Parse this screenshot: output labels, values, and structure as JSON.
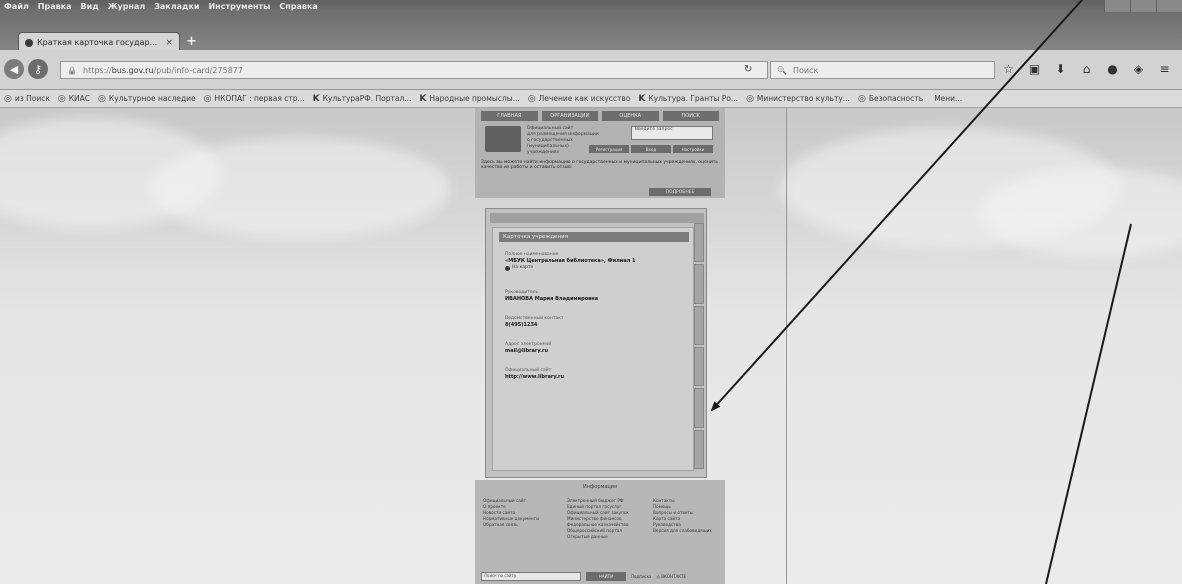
{
  "browser": {
    "menu": [
      "Файл",
      "Правка",
      "Вид",
      "Журнал",
      "Закладки",
      "Инструменты",
      "Справка"
    ],
    "tab_title": "Краткая карточка государ...",
    "tab_close": "×",
    "new_tab": "+",
    "url": {
      "prefix": "https://",
      "host": "bus.gov.ru",
      "path": "/pub/info-card/275877"
    },
    "search_placeholder": "Поиск",
    "bookmarks": [
      {
        "icon": "◎",
        "label": "из Поиск"
      },
      {
        "icon": "◎",
        "label": "КИАС"
      },
      {
        "icon": "◎",
        "label": "Культурное наследие"
      },
      {
        "icon": "◎",
        "label": "НКОПАГ : первая стр..."
      },
      {
        "icon": "K",
        "label": "КультураРФ. Портал..."
      },
      {
        "icon": "K",
        "label": "Народные промыслы..."
      },
      {
        "icon": "◎",
        "label": "Лечение как искусство"
      },
      {
        "icon": "K",
        "label": "Культура. Гранты Ро..."
      },
      {
        "icon": "◎",
        "label": "Министерство культу..."
      },
      {
        "icon": "◎",
        "label": "Безопасность"
      },
      {
        "icon": "",
        "label": "Мени..."
      }
    ]
  },
  "site": {
    "top_nav": [
      "ГЛАВНАЯ",
      "ОРГАНИЗАЦИИ",
      "ОЦЕНКА",
      "ПОИСК"
    ],
    "header_lines": [
      "Официальный сайт",
      "для размещения информации",
      "о государственных (муниципальных)",
      "учреждениях"
    ],
    "login_field": "Введите запрос",
    "header_buttons": [
      "Регистрация",
      "Вход",
      "Настройки"
    ],
    "notice": "Здесь вы можете найти информацию о государственных и муниципальных учреждениях, оценить качество их работы и оставить отзыв.",
    "notice_button": "ПОДРОБНЕЕ",
    "card": {
      "title": "Карточка учреждения",
      "fields": [
        {
          "label": "Полное наименование",
          "value": "«МБУК Центральная библиотека», Филиал 1",
          "sub": "На карте"
        },
        {
          "label": "Руководитель",
          "value": "ИВАНОВА Мария Владимировна",
          "sub": ""
        },
        {
          "label": "Ведомственный контакт",
          "value": "8(495)1234",
          "sub": ""
        },
        {
          "label": "Адрес электронной",
          "value": "mail@library.ru",
          "sub": ""
        },
        {
          "label": "Официальный сайт",
          "value": "http://www.library.ru",
          "sub": ""
        }
      ]
    },
    "footer": {
      "title": "Информация",
      "col1": [
        "Официальный сайт",
        "О проекте",
        "Новости сайта",
        "Нормативные документы",
        "Обратная связь"
      ],
      "col2": [
        "Электронный бюджет РФ",
        "Единый портал госуслуг",
        "Официальный сайт закупок",
        "Министерство финансов",
        "Федеральное казначейство",
        "Общероссийский портал",
        "Открытые данные"
      ],
      "col3": [
        "Контакты",
        "Помощь",
        "Вопросы и ответы",
        "Карта сайта",
        "Руководства",
        "Версия для слабовидящих"
      ],
      "search_placeholder": "Поиск по сайту",
      "search_button": "НАЙТИ",
      "text1": "Подписка",
      "text2": "◎ ВКОНТАКТЕ"
    }
  }
}
